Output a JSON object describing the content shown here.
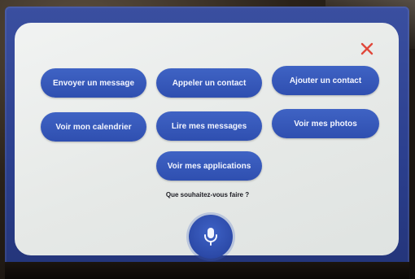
{
  "close": {
    "label": "×"
  },
  "actions": [
    {
      "id": "send-message",
      "label": "Envoyer un message"
    },
    {
      "id": "call-contact",
      "label": "Appeler un contact"
    },
    {
      "id": "add-contact",
      "label": "Ajouter un contact"
    },
    {
      "id": "view-calendar",
      "label": "Voir mon calendrier"
    },
    {
      "id": "read-messages",
      "label": "Lire mes messages"
    },
    {
      "id": "view-photos",
      "label": "Voir mes photos"
    },
    {
      "id": "view-apps",
      "label": "Voir mes applications"
    }
  ],
  "prompt": "Que souhaitez-vous faire ?",
  "mic": {
    "icon": "microphone-icon"
  },
  "colors": {
    "accent": "#3355bb",
    "close": "#e0483b",
    "panel": "#eceeed",
    "bezel": "#2b3f8e"
  }
}
